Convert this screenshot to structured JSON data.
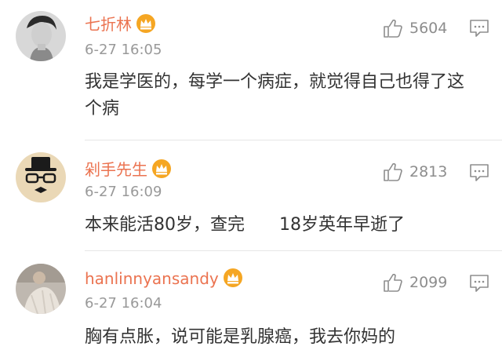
{
  "comments": [
    {
      "username": "七折林",
      "time": "6-27 16:05",
      "likes": "5604",
      "text": "我是学医的，每学一个病症，就觉得自己也得了这个病",
      "badge_icon": "crown-badge-icon",
      "like_icon": "thumbs-up-icon",
      "reply_icon": "comment-icon"
    },
    {
      "username": "剁手先生",
      "time": "6-27 16:09",
      "likes": "2813",
      "text": "本来能活80岁，查完　　18岁英年早逝了",
      "badge_icon": "crown-badge-icon",
      "like_icon": "thumbs-up-icon",
      "reply_icon": "comment-icon"
    },
    {
      "username": "hanlinnyansandy",
      "time": "6-27 16:04",
      "likes": "2099",
      "text": "胸有点胀，说可能是乳腺癌，我去你妈的",
      "badge_icon": "crown-badge-icon",
      "like_icon": "thumbs-up-icon",
      "reply_icon": "comment-icon"
    }
  ],
  "colors": {
    "username": "#eb7350",
    "muted": "#999999",
    "text": "#333333",
    "divider": "#e6e6e6",
    "badge": "#f5a623"
  }
}
